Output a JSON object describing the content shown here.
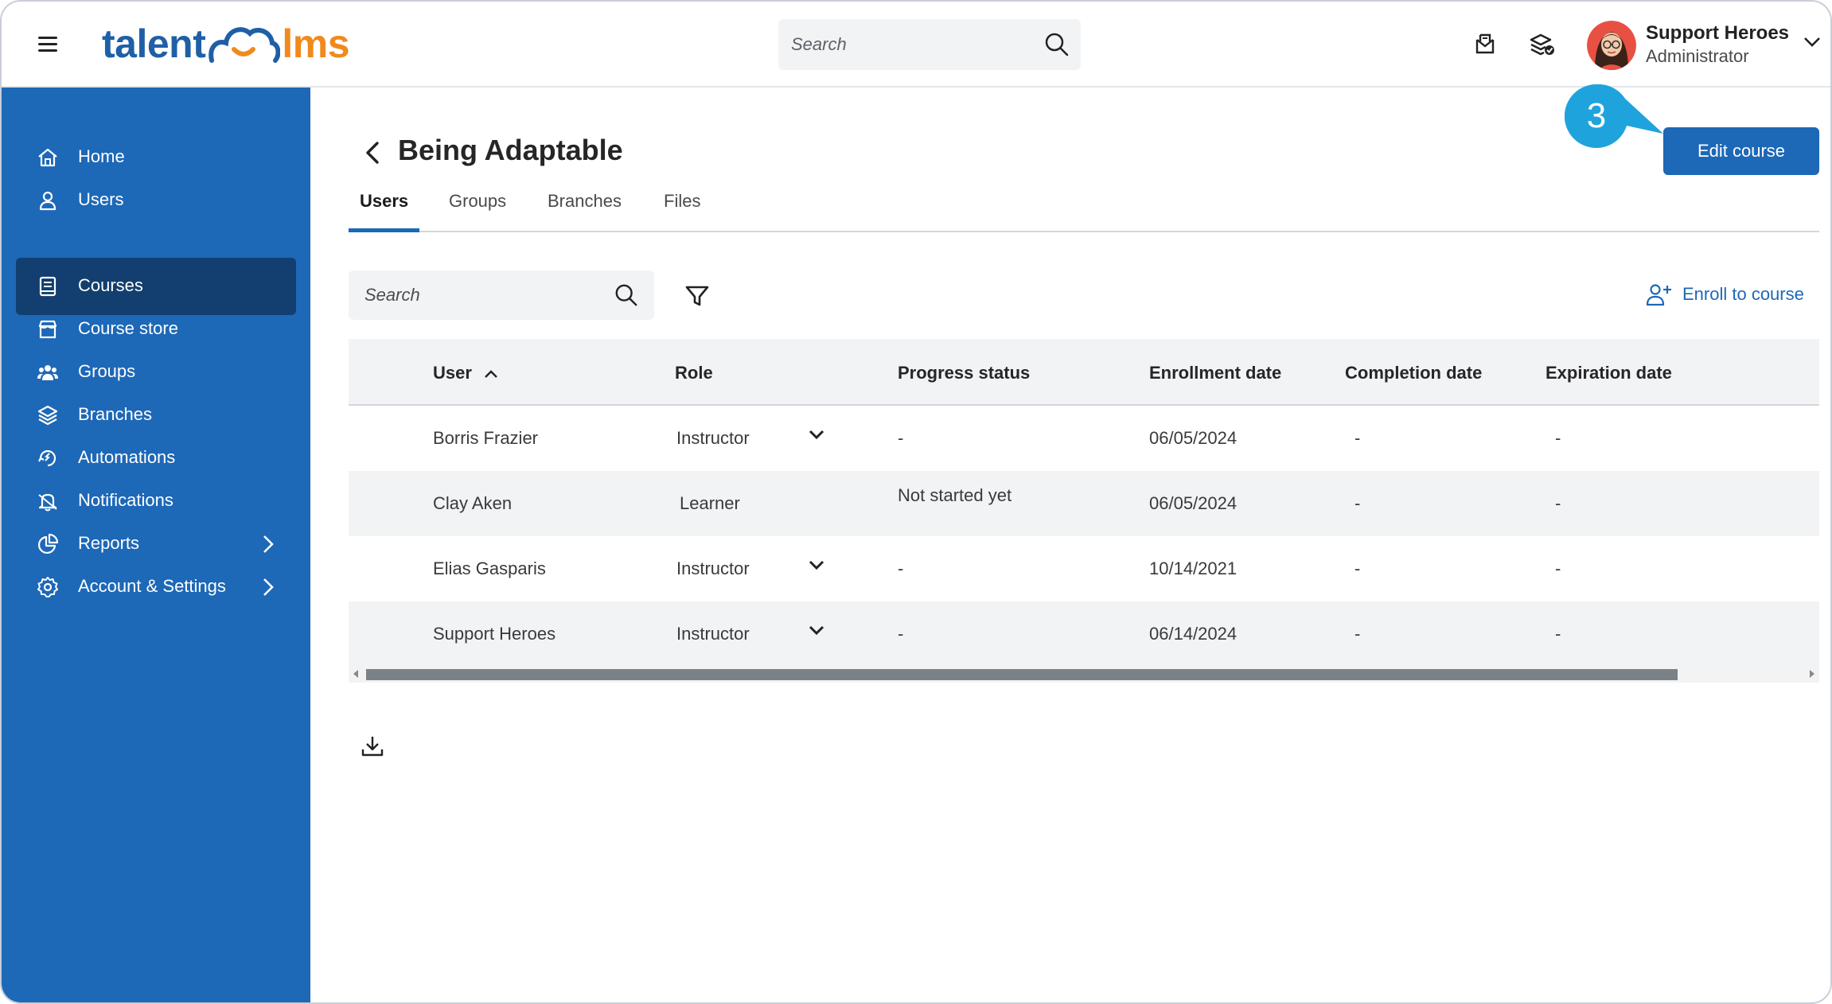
{
  "header": {
    "logo": {
      "part1": "talent",
      "part2": "lms"
    },
    "search_placeholder": "Search",
    "user": {
      "name": "Support Heroes",
      "role": "Administrator"
    }
  },
  "sidebar": {
    "items": [
      {
        "label": "Home",
        "icon": "home-icon"
      },
      {
        "label": "Users",
        "icon": "user-icon"
      },
      {
        "label": "Courses",
        "icon": "book-icon",
        "active": true
      },
      {
        "label": "Course store",
        "icon": "store-icon"
      },
      {
        "label": "Groups",
        "icon": "group-icon"
      },
      {
        "label": "Branches",
        "icon": "branches-icon"
      },
      {
        "label": "Automations",
        "icon": "automations-icon"
      },
      {
        "label": "Notifications",
        "icon": "bell-icon"
      },
      {
        "label": "Reports",
        "icon": "pie-chart-icon",
        "has_submenu": true
      },
      {
        "label": "Account & Settings",
        "icon": "gear-icon",
        "has_submenu": true
      }
    ]
  },
  "page": {
    "title": "Being Adaptable",
    "edit_button": "Edit course",
    "step_badge": "3",
    "tabs": [
      "Users",
      "Groups",
      "Branches",
      "Files"
    ],
    "active_tab": "Users",
    "search_placeholder": "Search",
    "enroll_label": "Enroll to course"
  },
  "table": {
    "columns": [
      "User",
      "Role",
      "Progress status",
      "Enrollment date",
      "Completion date",
      "Expiration date"
    ],
    "sort_column": "User",
    "rows": [
      {
        "user": "Borris Frazier",
        "role": "Instructor",
        "progress": "-",
        "enrolled": "06/05/2024",
        "completed": "-",
        "expires": "-"
      },
      {
        "user": "Clay Aken",
        "role": "Learner",
        "progress": "Not started yet",
        "enrolled": "06/05/2024",
        "completed": "-",
        "expires": "-"
      },
      {
        "user": "Elias Gasparis",
        "role": "Instructor",
        "progress": "-",
        "enrolled": "10/14/2021",
        "completed": "-",
        "expires": "-"
      },
      {
        "user": "Support Heroes",
        "role": "Instructor",
        "progress": "-",
        "enrolled": "06/14/2024",
        "completed": "-",
        "expires": "-"
      }
    ]
  },
  "colors": {
    "sidebar": "#1d68b7",
    "sidebar_active": "#123f6f",
    "accent": "#1d68b7",
    "logo_blue": "#1f5fa6",
    "logo_orange": "#f08a1c",
    "badge": "#1fa3dc"
  }
}
